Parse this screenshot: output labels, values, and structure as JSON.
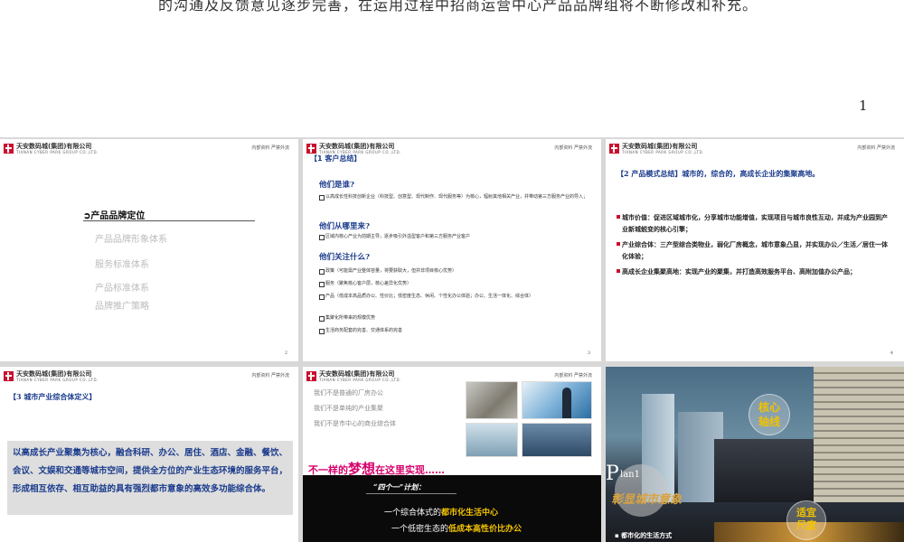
{
  "top": {
    "text": "的沟通及反馈意见逐步完善，在运用过程中招商运营中心产品品牌组将不断修改和补充。",
    "page_number": "1"
  },
  "company": {
    "name_cn": "天安数码城(集团)有限公司",
    "name_en": "TIANAN CYBER PARK GROUP CO.,LTD.",
    "header_right": "内部资料  严禁外流"
  },
  "slide1": {
    "title": "产品品牌定位",
    "items": [
      "产品品牌形象体系",
      "服务标准体系",
      "产品标准体系",
      "品牌推广策略"
    ],
    "page": "2"
  },
  "slide2": {
    "section": "【1 客户总结】",
    "q1": "他们是谁?",
    "a1": "以高成长性科技创新企业（科技型、创意型、现代制作、现代服务等）为核心，辐射其他相关产业，并带动第三方服务产业的导入；",
    "q2": "他们从哪里来?",
    "a2": "区域内核心产业为前期主导，逐步吸引外溢型客户和第三方服务产业客户",
    "q3": "他们关注什么?",
    "a3": [
      "政策（可能需产业整体容量，将要获取大，但并非项目核心优势）",
      "服务（聚焦核心客户层，核心差异化优势）",
      "产品（低成本高品质办公、性价比；低密度生态、休闲、个性化办公体验；办公、生活一体化、综合体）",
      "集聚化所带来的规模优势",
      "生活商务配套的完善、交通体系的完善"
    ],
    "page": "3"
  },
  "slide3": {
    "title": "【2 产品模式总结】城市的，综合的，高成长企业的集聚高地。",
    "bullets": [
      "城市价值：促进区域城市化，分享城市功能增值，实现项目与城市良性互动，并成为产业园到产业新城蜕变的核心引擎；",
      "产业综合体：三产型综合类物业，弱化厂房概念，城市意象凸显，并实现办公／生活／居住一体化体验；",
      "高成长企业集聚高地：实现产业的聚集，并打造高效服务平台、高附加值办公产品；"
    ],
    "page": "4"
  },
  "slide4": {
    "title": "【3 城市产业综合体定义】",
    "body": "以高成长产业聚集为核心，融合科研、办公、居住、酒店、金融、餐饮、会议、文娱和交通等城市空间，提供全方位的产业生态环境的服务平台，形成相互依存、相互助益的具有强烈都市意象的高效多功能综合体。"
  },
  "slide5": {
    "lines": [
      "我们不是普通的厂房办公",
      "我们不是单纯的产业集聚",
      "我们不是市中心的商业综合体"
    ],
    "dream_pre": "不一样的",
    "dream_big": "梦想",
    "dream_post": "在这里实现……",
    "plan_title": "“四个一”计划：",
    "row1_pre": "一个综合体式的",
    "row1_hl": "都市化生活中心",
    "row2_pre": "一个低密生态的",
    "row2_hl": "低成本高性价比办公"
  },
  "slide6": {
    "plan_big": "P",
    "plan_small": "lan1",
    "plan_num": "1",
    "subtitle": "彰显城市意象",
    "core_label": "核心\n轴线",
    "fit_label": "适宜\n尺度",
    "foot": "▪ 都市化的生活方式"
  }
}
